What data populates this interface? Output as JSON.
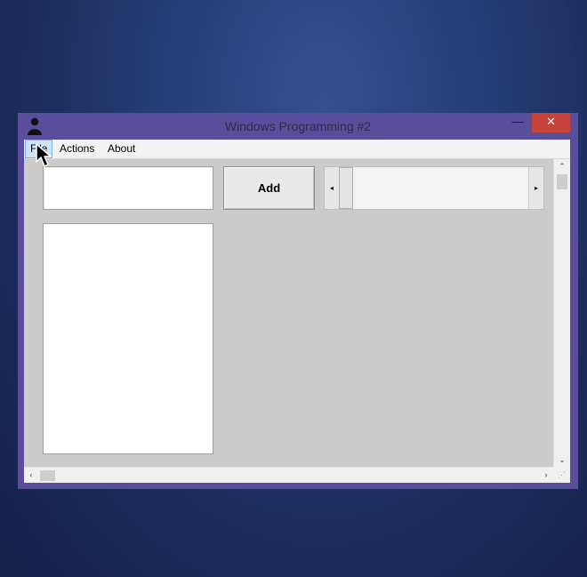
{
  "window": {
    "title": "Windows Programming #2",
    "controls": {
      "minimize": "—",
      "maximize": "☐",
      "close": "✕"
    }
  },
  "menu": {
    "items": [
      "File",
      "Actions",
      "About"
    ]
  },
  "form": {
    "text_input_value": "",
    "add_button_label": "Add",
    "scrollbar_arrows": {
      "left": "◂",
      "right": "▸"
    }
  },
  "scrollbars": {
    "vertical": {
      "up": "⌃",
      "down": "⌄"
    },
    "horizontal": {
      "left": "‹",
      "right": "›"
    },
    "grip": "⋰"
  },
  "colors": {
    "desktop": "#1c2c5c",
    "window_frame": "#5a4e9c",
    "close_button": "#c7433a",
    "client_area": "#cbcbcb",
    "menu_highlight": "#cde4f7"
  },
  "icons": {
    "app": "person-icon",
    "cursor": "arrow-cursor-icon"
  }
}
